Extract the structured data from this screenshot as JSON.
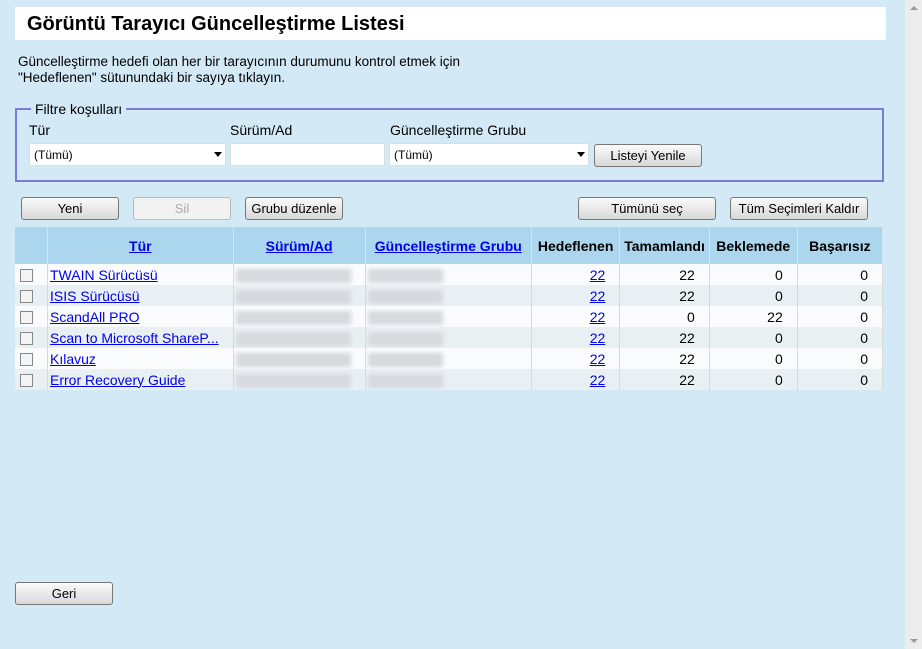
{
  "title": "Görüntü Tarayıcı Güncelleştirme Listesi",
  "description": [
    "Güncelleştirme hedefi olan her bir tarayıcının durumunu kontrol etmek için",
    "\"Hedeflenen\" sütunundaki bir sayıya tıklayın."
  ],
  "filter": {
    "legend": "Filtre koşulları",
    "type_label": "Tür",
    "type_value": "(Tümü)",
    "version_label": "Sürüm/Ad",
    "version_value": "",
    "group_label": "Güncelleştirme Grubu",
    "group_value": "(Tümü)",
    "refresh": "Listeyi Yenile"
  },
  "toolbar": {
    "new": "Yeni",
    "delete": "Sil",
    "edit_group": "Grubu düzenle",
    "select_all": "Tümünü seç",
    "clear_all": "Tüm Seçimleri Kaldır"
  },
  "table": {
    "headers": [
      "Tür",
      "Sürüm/Ad",
      "Güncelleştirme Grubu",
      "Hedeflenen",
      "Tamamlandı",
      "Beklemede",
      "Başarısız"
    ],
    "rows": [
      {
        "type": "TWAIN Sürücüsü",
        "targeted": "22",
        "completed": "22",
        "pending": "0",
        "failed": "0"
      },
      {
        "type": "ISIS Sürücüsü",
        "targeted": "22",
        "completed": "22",
        "pending": "0",
        "failed": "0"
      },
      {
        "type": "ScandAll PRO",
        "targeted": "22",
        "completed": "0",
        "pending": "22",
        "failed": "0"
      },
      {
        "type": "Scan to Microsoft ShareP...",
        "targeted": "22",
        "completed": "22",
        "pending": "0",
        "failed": "0"
      },
      {
        "type": "Kılavuz",
        "targeted": "22",
        "completed": "22",
        "pending": "0",
        "failed": "0"
      },
      {
        "type": "Error Recovery Guide",
        "targeted": "22",
        "completed": "22",
        "pending": "0",
        "failed": "0"
      }
    ]
  },
  "back": "Geri",
  "colors": {
    "background": "#d3eaf6",
    "header": "#acd6ee",
    "link": "#0000ee",
    "filter_border": "#7b7bdc"
  }
}
